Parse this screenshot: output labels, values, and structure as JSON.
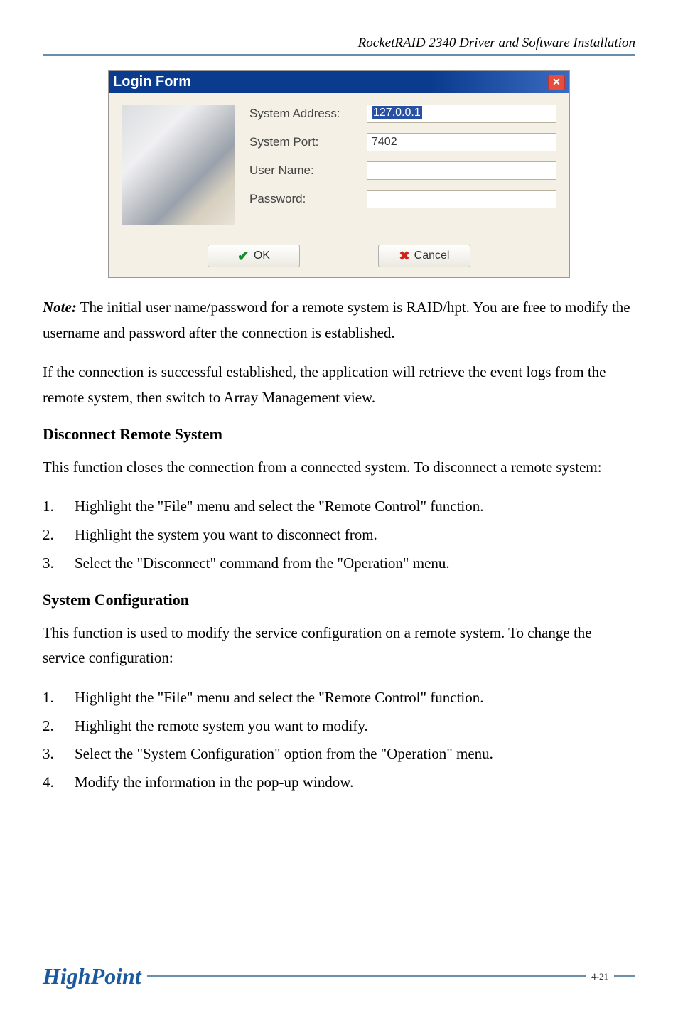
{
  "header": "RocketRAID 2340 Driver and Software Installation",
  "login": {
    "title": "Login Form",
    "labels": {
      "system_address": "System Address:",
      "system_port": "System Port:",
      "user_name": "User Name:",
      "password": "Password:"
    },
    "values": {
      "system_address": "127.0.0.1",
      "system_port": "7402",
      "user_name": "",
      "password": ""
    },
    "buttons": {
      "ok": "OK",
      "cancel": "Cancel"
    }
  },
  "paragraphs": {
    "note_prefix": "Note:",
    "note_rest": " The initial user name/password for a remote system is RAID/hpt.  You are free to modify the username and password after the connection is established.",
    "p2": "If the connection is successful established, the application will retrieve the event logs from the remote system, then switch to Array Management view.",
    "disconnect_heading": "Disconnect Remote System",
    "p3": "This function closes the connection from a connected system.  To disconnect a remote system:",
    "sysconf_heading": "System Configuration",
    "p4": "This function is used to modify the service configuration on a remote system.  To change the service configuration:"
  },
  "list1": [
    "Highlight the \"File\" menu and select the \"Remote Control\" function.",
    "Highlight the system you want to disconnect from.",
    "Select the \"Disconnect\" command from the \"Operation\" menu."
  ],
  "list2": [
    "Highlight the \"File\" menu and select the \"Remote Control\" function.",
    "Highlight the remote system you want to modify.",
    "Select the \"System Configuration\" option from the \"Operation\" menu.",
    "Modify the information in the pop-up window."
  ],
  "footer": {
    "logo": "HighPoint",
    "page": "4-21"
  }
}
